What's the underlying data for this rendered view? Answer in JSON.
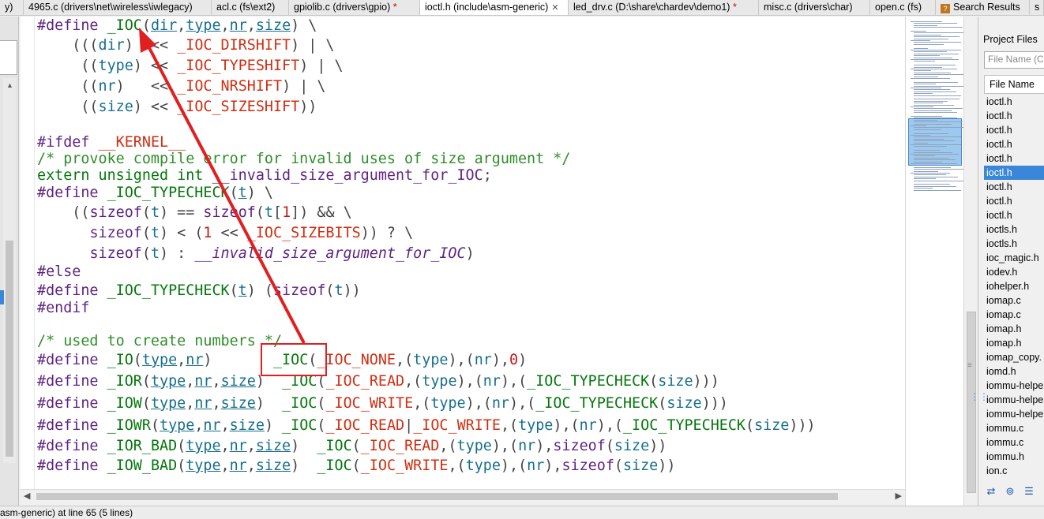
{
  "tabs": [
    {
      "label": "y)",
      "modified": false
    },
    {
      "label": "4965.c (drivers\\net\\wireless\\iwlegacy)",
      "modified": false
    },
    {
      "label": "acl.c (fs\\ext2)",
      "modified": false
    },
    {
      "label": "gpiolib.c (drivers\\gpio)",
      "modified": true,
      "marker": "*"
    },
    {
      "label": "ioctl.h (include\\asm-generic)",
      "active": true,
      "close": "✕"
    },
    {
      "label": "led_drv.c (D:\\share\\chardev\\demo1)",
      "modified": true,
      "marker": "*"
    },
    {
      "label": "misc.c (drivers\\char)",
      "modified": false
    },
    {
      "label": "open.c (fs)",
      "modified": false
    },
    {
      "label": "Search Results",
      "icon": "search-results-icon"
    },
    {
      "label": "s",
      "modified": false
    }
  ],
  "code": {
    "l1": {
      "a": "#define ",
      "b": "_IOC",
      "c": "(",
      "d": "dir",
      "e": ",",
      "f": "type",
      "g": ",",
      "h": "nr",
      "i": ",",
      "j": "size",
      "k": ") \\"
    },
    "l2": {
      "a": "    (((",
      "b": "dir",
      "c": ")  << ",
      "d": "_IOC_DIRSHIFT",
      "e": ") | \\"
    },
    "l3": {
      "a": "     ((",
      "b": "type",
      "c": ") << ",
      "d": "_IOC_TYPESHIFT",
      "e": ") | \\"
    },
    "l4": {
      "a": "     ((",
      "b": "nr",
      "c": ")   << ",
      "d": "_IOC_NRSHIFT",
      "e": ") | \\"
    },
    "l5": {
      "a": "     ((",
      "b": "size",
      "c": ") << ",
      "d": "_IOC_SIZESHIFT",
      "e": "))"
    },
    "l6": {
      "a": "#ifdef ",
      "b": "__KERNEL__"
    },
    "l7": {
      "a": "/* provoke compile error for invalid uses of size argument */"
    },
    "l8": {
      "a": "extern unsigned int ",
      "b": "__invalid_size_argument_for_IOC",
      "c": ";"
    },
    "l9": {
      "a": "#define ",
      "b": "_IOC_TYPECHECK",
      "c": "(",
      "d": "t",
      "e": ") \\"
    },
    "l10": {
      "a": "    ((",
      "b": "sizeof",
      "c": "(",
      "d": "t",
      "e": ") == ",
      "f": "sizeof",
      "g": "(",
      "h": "t",
      "i": "[",
      "j": "1",
      "k": "]) && \\"
    },
    "l11": {
      "a": "      ",
      "b": "sizeof",
      "c": "(",
      "d": "t",
      "e": ") < (",
      "f": "1",
      "g": " << ",
      "h": "_IOC_SIZEBITS",
      "i": ")) ? \\"
    },
    "l12": {
      "a": "      ",
      "b": "sizeof",
      "c": "(",
      "d": "t",
      "e": ") : ",
      "f": "__invalid_size_argument_for_IOC",
      "g": ")"
    },
    "l13": {
      "a": "#else"
    },
    "l14": {
      "a": "#define ",
      "b": "_IOC_TYPECHECK",
      "c": "(",
      "d": "t",
      "e": ") (",
      "f": "sizeof",
      "g": "(",
      "h": "t",
      "i": "))"
    },
    "l15": {
      "a": "#endif"
    },
    "l16": {
      "a": "/* used to create numbers */"
    },
    "l17": {
      "a": "#define ",
      "b": "_IO",
      "c": "(",
      "d": "type",
      "e": ",",
      "f": "nr",
      "g": ")       ",
      "h": "_IOC",
      "i": "(",
      "j": "_IOC_NONE",
      "k": ",(",
      "l": "type",
      "m": "),(",
      "n": "nr",
      "o": "),",
      "p": "0",
      "q": ")"
    },
    "l18": {
      "a": "#define ",
      "b": "_IOR",
      "c": "(",
      "d": "type",
      "e": ",",
      "f": "nr",
      "g": ",",
      "h": "size",
      "i": ")  ",
      "j": "_IOC",
      "k": "(",
      "l": "_IOC_READ",
      "m": ",(",
      "n": "type",
      "o": "),(",
      "p": "nr",
      "q": "),(",
      "r": "_IOC_TYPECHECK",
      "s": "(",
      "t": "size",
      "u": ")))"
    },
    "l19": {
      "a": "#define ",
      "b": "_IOW",
      "c": "(",
      "d": "type",
      "e": ",",
      "f": "nr",
      "g": ",",
      "h": "size",
      "i": ")  ",
      "j": "_IOC",
      "k": "(",
      "l": "_IOC_WRITE",
      "m": ",(",
      "n": "type",
      "o": "),(",
      "p": "nr",
      "q": "),(",
      "r": "_IOC_TYPECHECK",
      "s": "(",
      "t": "size",
      "u": ")))"
    },
    "l20": {
      "a": "#define ",
      "b": "_IOWR",
      "c": "(",
      "d": "type",
      "e": ",",
      "f": "nr",
      "g": ",",
      "h": "size",
      "i": ") ",
      "j": "_IOC",
      "k": "(",
      "l": "_IOC_READ",
      "m": "|",
      "n": "_IOC_WRITE",
      "o": ",(",
      "p": "type",
      "q": "),(",
      "r": "nr",
      "s": "),(",
      "t": "_IOC_TYPECHECK",
      "u": "(",
      "v": "size",
      "w": ")))"
    },
    "l21": {
      "a": "#define ",
      "b": "_IOR_BAD",
      "c": "(",
      "d": "type",
      "e": ",",
      "f": "nr",
      "g": ",",
      "h": "size",
      "i": ")  ",
      "j": "_IOC",
      "k": "(",
      "l": "_IOC_READ",
      "m": ",(",
      "n": "type",
      "o": "),(",
      "p": "nr",
      "q": "),",
      "r": "sizeof",
      "s": "(",
      "t": "size",
      "u": "))"
    },
    "l22": {
      "a": "#define ",
      "b": "_IOW_BAD",
      "c": "(",
      "d": "type",
      "e": ",",
      "f": "nr",
      "g": ",",
      "h": "size",
      "i": ")  ",
      "j": "_IOC",
      "k": "(",
      "l": "_IOC_WRITE",
      "m": ",(",
      "n": "type",
      "o": "),(",
      "p": "nr",
      "q": "),",
      "r": "sizeof",
      "s": "(",
      "t": "size",
      "u": "))"
    }
  },
  "project_panel": {
    "title": "Project Files",
    "filter_placeholder": "File Name (C",
    "column_header": "File Name",
    "files": [
      "ioctl.h",
      "ioctl.h",
      "ioctl.h",
      "ioctl.h",
      "ioctl.h",
      "ioctl.h",
      "ioctl.h",
      "ioctl.h",
      "ioctl.h",
      "ioctls.h",
      "ioctls.h",
      "ioc_magic.h",
      "iodev.h",
      "iohelper.h",
      "iomap.c",
      "iomap.c",
      "iomap.h",
      "iomap.h",
      "iomap_copy.",
      "iomd.h",
      "iommu-helpe",
      "iommu-helpe",
      "iommu-helpe",
      "iommu.c",
      "iommu.c",
      "iommu.h",
      "ion.c"
    ],
    "selected_index": 5
  },
  "status_bar": {
    "text": "asm-generic) at line 65 (5 lines)"
  },
  "colors": {
    "selection": "#3a86d8",
    "annotation": "#e02020",
    "keyword": "#5f2382",
    "macro": "#d12d10",
    "param": "#166e8c",
    "comment": "#2f8d29",
    "function": "#04760b"
  }
}
